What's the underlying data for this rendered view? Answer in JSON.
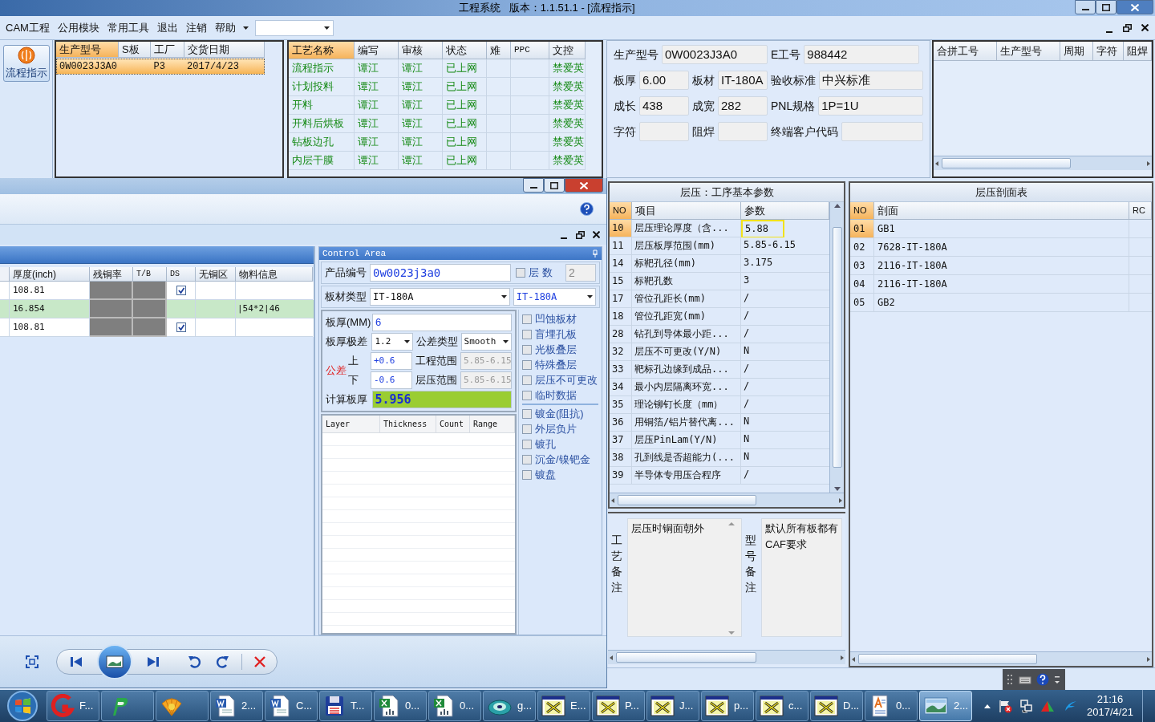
{
  "window": {
    "title": "工程系统   版本：1.1.51.1 - [流程指示]"
  },
  "menu": [
    "CAM工程",
    "公用模块",
    "常用工具",
    "退出",
    "注销",
    "帮助"
  ],
  "nav": [
    {
      "label": "流程指示",
      "selected": true
    }
  ],
  "orders": {
    "columns": [
      {
        "label": "生产型号",
        "selected": true
      },
      {
        "label": "S板",
        "selected": false
      },
      {
        "label": "工厂",
        "selected": false
      },
      {
        "label": "交货日期",
        "selected": false
      }
    ],
    "rows": [
      {
        "model": "0W0023J3A0",
        "factory": "P3",
        "date": "2017/4/23",
        "selected": true
      }
    ]
  },
  "processes": {
    "columns": [
      {
        "label": "工艺名称",
        "selected": true
      },
      {
        "label": "编写",
        "selected": false
      },
      {
        "label": "审核",
        "selected": false
      },
      {
        "label": "状态",
        "selected": false
      },
      {
        "label": "难",
        "selected": false
      },
      {
        "label": "PPC",
        "selected": false
      },
      {
        "label": "文控",
        "selected": false
      }
    ],
    "rows": [
      {
        "name": "流程指示",
        "author": "谭江",
        "reviewer": "谭江",
        "status": "已上网",
        "controller": "禁爱英"
      },
      {
        "name": "计划投料",
        "author": "谭江",
        "reviewer": "谭江",
        "status": "已上网",
        "controller": "禁爱英"
      },
      {
        "name": "开料",
        "author": "谭江",
        "reviewer": "谭江",
        "status": "已上网",
        "controller": "禁爱英"
      },
      {
        "name": "开料后烘板",
        "author": "谭江",
        "reviewer": "谭江",
        "status": "已上网",
        "controller": "禁爱英"
      },
      {
        "name": "钻板边孔",
        "author": "谭江",
        "reviewer": "谭江",
        "status": "已上网",
        "controller": "禁爱英"
      },
      {
        "name": "内层干膜",
        "author": "谭江",
        "reviewer": "谭江",
        "status": "已上网",
        "controller": "禁爱英"
      }
    ]
  },
  "info": {
    "fields": [
      {
        "label": "生产型号",
        "value": "0W0023J3A0"
      },
      {
        "label": "E工号",
        "value": "988442"
      },
      {
        "label": "板厚",
        "value": "6.00"
      },
      {
        "label": "板材",
        "value": "IT-180A"
      },
      {
        "label": "验收标准",
        "value": "中兴标准"
      },
      {
        "label": "成长",
        "value": "438"
      },
      {
        "label": "成宽",
        "value": "282"
      },
      {
        "label": "PNL规格",
        "value": "1P=1U"
      },
      {
        "label": "字符"
      },
      {
        "label": "阻焊"
      },
      {
        "label": "终端客户代码"
      }
    ]
  },
  "merge_grid": {
    "columns": [
      "合拼工号",
      "生产型号",
      "周期",
      "字符",
      "阻焊"
    ]
  },
  "params": {
    "title": "层压：工序基本参数",
    "columns": [
      "NO",
      "项目",
      "参数"
    ],
    "rows": [
      {
        "no": "10",
        "item": "层压理论厚度（含...",
        "value": "5.88",
        "selected": true
      },
      {
        "no": "11",
        "item": "层压板厚范围(mm)",
        "value": "5.85-6.15",
        "selected": false
      },
      {
        "no": "14",
        "item": "标靶孔径(mm)",
        "value": "3.175",
        "selected": false
      },
      {
        "no": "15",
        "item": "标靶孔数",
        "value": "3",
        "selected": false
      },
      {
        "no": "17",
        "item": "管位孔距长(mm)",
        "value": "/",
        "selected": false
      },
      {
        "no": "18",
        "item": "管位孔距宽(mm)",
        "value": "/",
        "selected": false
      },
      {
        "no": "28",
        "item": "钻孔到导体最小距...",
        "value": "/",
        "selected": false
      },
      {
        "no": "32",
        "item": "层压不可更改(Y/N)",
        "value": "N",
        "selected": false
      },
      {
        "no": "33",
        "item": "靶标孔边缘到成品...",
        "value": "/",
        "selected": false
      },
      {
        "no": "34",
        "item": "最小内层隔离环宽...",
        "value": "/",
        "selected": false
      },
      {
        "no": "35",
        "item": "理论铆钉长度（mm）",
        "value": "/",
        "selected": false
      },
      {
        "no": "36",
        "item": "用铜箔/铝片替代离...",
        "value": "N",
        "selected": false
      },
      {
        "no": "37",
        "item": "层压PinLam(Y/N)",
        "value": "N",
        "selected": false
      },
      {
        "no": "38",
        "item": "孔到线是否超能力(...",
        "value": "N",
        "selected": false
      },
      {
        "no": "39",
        "item": "半导体专用压合程序",
        "value": "/",
        "selected": false
      }
    ]
  },
  "notes": [
    {
      "label": "工艺备注",
      "lines": [
        "层压时铜面朝外"
      ]
    },
    {
      "label": "型号备注",
      "lines": [
        "默认所有板都有",
        "CAF要求"
      ]
    }
  ],
  "profile": {
    "title": "层压剖面表",
    "columns": [
      "NO",
      "剖面",
      "RC"
    ],
    "rows": [
      {
        "no": "01",
        "name": "GB1",
        "selected": true
      },
      {
        "no": "02",
        "name": "7628-IT-180A",
        "selected": false
      },
      {
        "no": "03",
        "name": "2116-IT-180A",
        "selected": false
      },
      {
        "no": "04",
        "name": "2116-IT-180A",
        "selected": false
      },
      {
        "no": "05",
        "name": "GB2",
        "selected": false
      }
    ]
  },
  "viewer": {
    "grid": {
      "columns": [
        "厚度(inch)",
        "残铜率",
        "T/B",
        "DS",
        "无铜区",
        "物料信息"
      ],
      "rows": [
        {
          "thickness": "108.81",
          "has_checkbox": true,
          "checked": true,
          "selected": false
        },
        {
          "thickness": "16.854",
          "has_checkbox": false,
          "material": "|54*2|46",
          "selected": true
        },
        {
          "thickness": "108.81",
          "has_checkbox": true,
          "checked": true,
          "selected": false
        }
      ]
    },
    "control_area": {
      "title": "Control Area",
      "product_no": {
        "label": "产品编号",
        "value": "0w0023j3a0"
      },
      "layers": {
        "label": "层 数",
        "checked": false,
        "value": "2"
      },
      "board_type": {
        "label": "板材类型",
        "value": "IT-180A",
        "value_2": "IT-180A"
      },
      "thickness": {
        "label": "板厚(MM)",
        "value": "6"
      },
      "thickness_range": {
        "label": "板厚极差",
        "value": "1.2"
      },
      "tolerance_type": {
        "label": "公差类型",
        "value": "Smooth"
      },
      "tolerance": {
        "label": "公差",
        "upper_label": "上",
        "upper": "+0.6",
        "lower_label": "下",
        "lower": "-0.6"
      },
      "eng_range": {
        "label": "工程范围",
        "value": "5.85-6.15"
      },
      "lam_range": {
        "label": "层压范围",
        "value": "5.85-6.15"
      },
      "calc": {
        "label": "计算板厚",
        "value": "5.956"
      },
      "options": [
        {
          "label": "凹蚀板材",
          "checked": false
        },
        {
          "label": "盲埋孔板",
          "checked": false
        },
        {
          "label": "光板叠层",
          "checked": false
        },
        {
          "label": "特殊叠层",
          "checked": false
        },
        {
          "label": "层压不可更改",
          "checked": false
        },
        {
          "label": "临时数据",
          "checked": false
        }
      ],
      "options_2": [
        {
          "label": "镀金(阻抗)",
          "checked": false
        },
        {
          "label": "外层负片",
          "checked": false
        },
        {
          "label": "镀孔",
          "checked": false
        },
        {
          "label": "沉金/镍钯金",
          "checked": false
        },
        {
          "label": "镀盘",
          "checked": false
        }
      ],
      "layer_table": {
        "columns": [
          "Layer",
          "Thickness",
          "Count",
          "Range"
        ]
      }
    }
  },
  "taskbar": {
    "items": [
      {
        "kind": "start",
        "selected": false
      },
      {
        "kind": "red-g",
        "label": "F...",
        "selected": false
      },
      {
        "kind": "green-p",
        "selected": false
      },
      {
        "kind": "shell",
        "selected": false
      },
      {
        "kind": "word",
        "label": "2...",
        "selected": false
      },
      {
        "kind": "word",
        "label": "C...",
        "selected": false
      },
      {
        "kind": "floppy",
        "label": "T...",
        "selected": false
      },
      {
        "kind": "excel",
        "label": "0...",
        "selected": false
      },
      {
        "kind": "excel",
        "label": "0...",
        "selected": false
      },
      {
        "kind": "disc",
        "label": "g...",
        "selected": false
      },
      {
        "kind": "xwin",
        "label": "E...",
        "selected": false
      },
      {
        "kind": "xwin",
        "label": "P...",
        "selected": false
      },
      {
        "kind": "xwin",
        "label": "J...",
        "selected": false
      },
      {
        "kind": "xwin",
        "label": "p...",
        "selected": false
      },
      {
        "kind": "xwin",
        "label": "c...",
        "selected": false
      },
      {
        "kind": "xwin",
        "label": "D...",
        "selected": false
      },
      {
        "kind": "notepad",
        "label": "0...",
        "selected": false
      },
      {
        "kind": "photo",
        "label": "2...",
        "selected": true
      }
    ],
    "clock": {
      "time": "21:16",
      "date": "2017/4/21"
    }
  }
}
